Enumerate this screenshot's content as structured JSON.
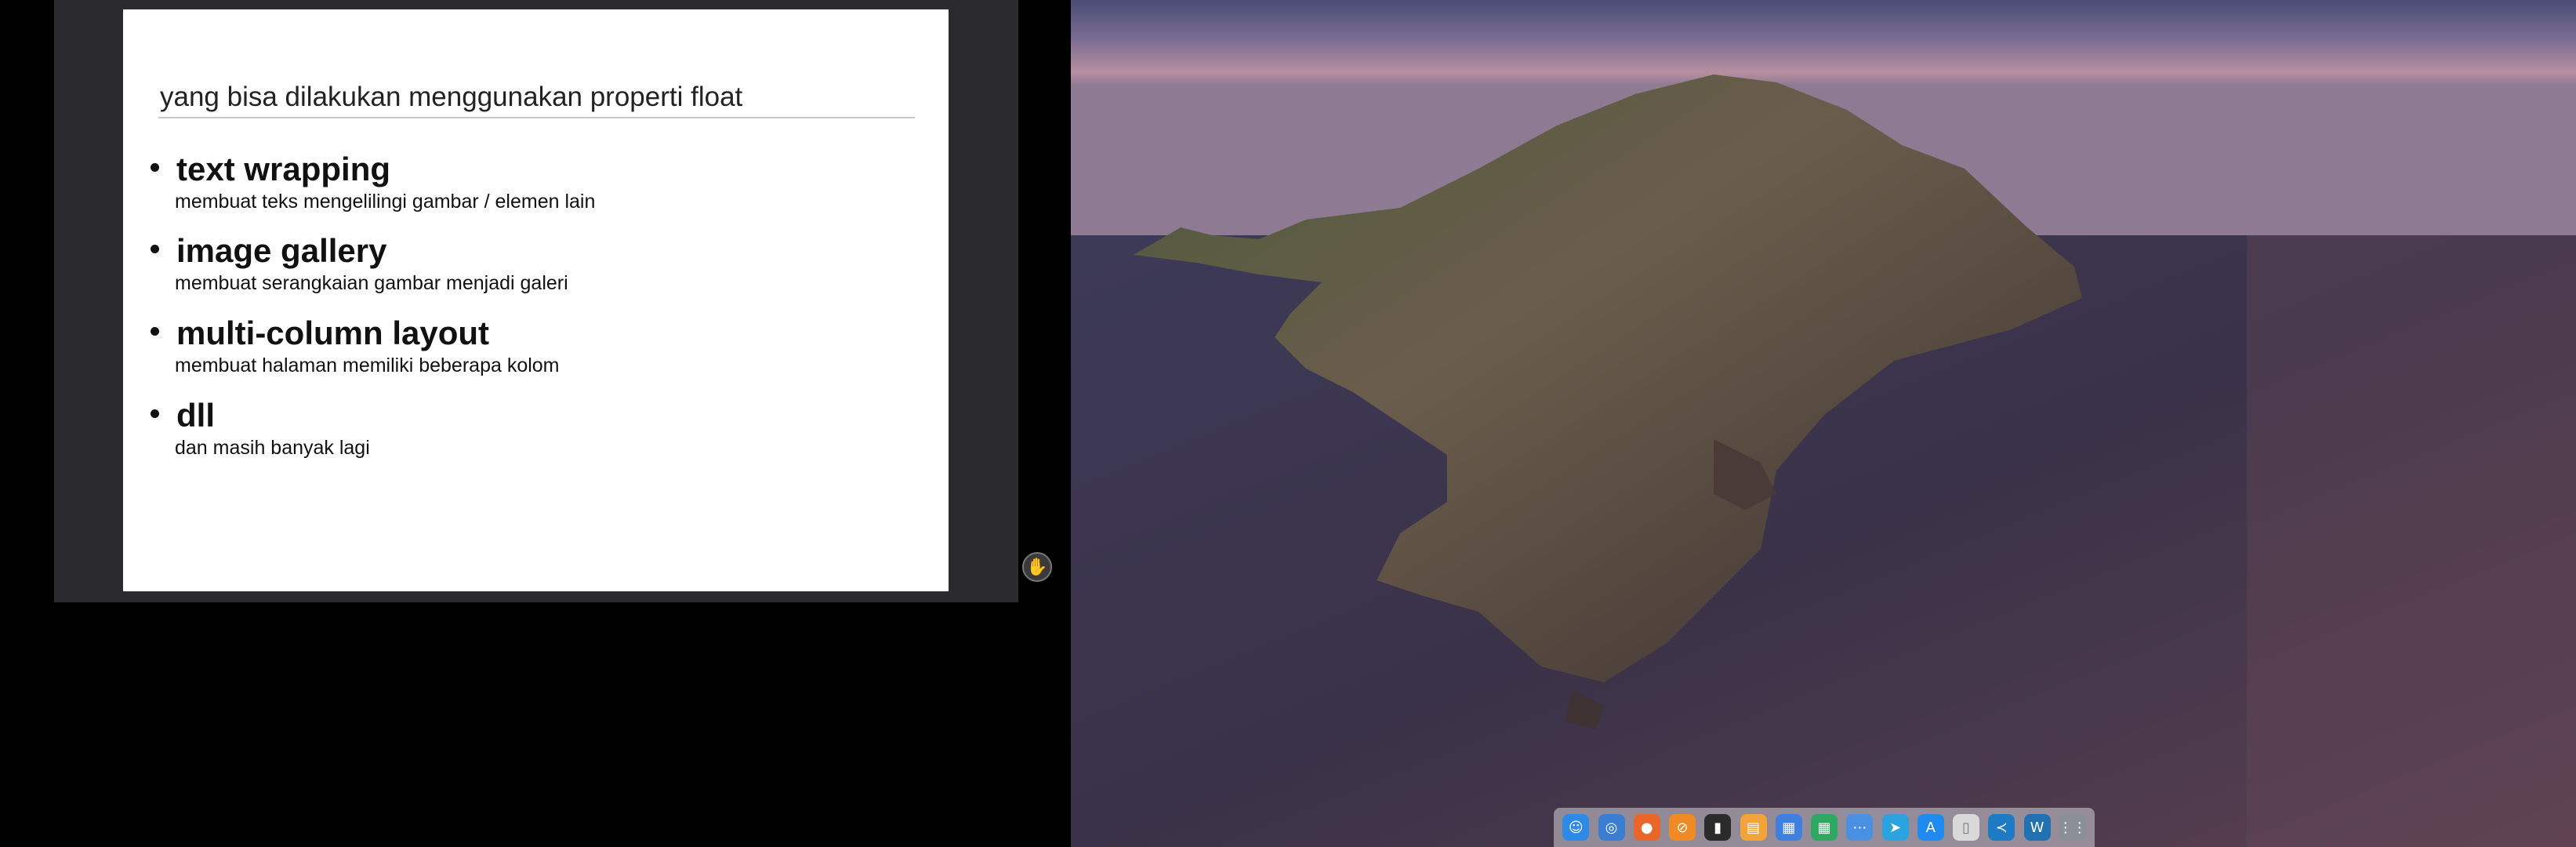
{
  "slide": {
    "title": "yang bisa dilakukan menggunakan properti float",
    "bullets": [
      {
        "heading": "text wrapping",
        "description": "membuat teks mengelilingi gambar / elemen lain"
      },
      {
        "heading": "image gallery",
        "description": "membuat serangkaian gambar menjadi galeri"
      },
      {
        "heading": "multi-column layout",
        "description": "membuat halaman memiliki beberapa kolom"
      },
      {
        "heading": "dll",
        "description": "dan masih banyak lagi"
      }
    ]
  },
  "presenter": {
    "hand_icon": "hand-icon"
  },
  "dock": {
    "items": [
      {
        "icon": "finder-icon",
        "color": "#2f8ae6"
      },
      {
        "icon": "chrome-icon",
        "color": "#3b7ed1"
      },
      {
        "icon": "firefox-icon",
        "color": "#e8662a"
      },
      {
        "icon": "safari-icon",
        "color": "#f08a24"
      },
      {
        "icon": "terminal-icon",
        "color": "#2b2b2b"
      },
      {
        "icon": "pages-icon",
        "color": "#f2a33a"
      },
      {
        "icon": "docs-icon",
        "color": "#3f7fe0"
      },
      {
        "icon": "sheets-icon",
        "color": "#2ea760"
      },
      {
        "icon": "messenger-icon",
        "color": "#4a90e2"
      },
      {
        "icon": "telegram-icon",
        "color": "#2aa3de"
      },
      {
        "icon": "app-store-icon",
        "color": "#1f8bf0"
      },
      {
        "icon": "file-icon",
        "color": "#d9d9d9"
      },
      {
        "icon": "vscode-icon",
        "color": "#1f7ac4"
      },
      {
        "icon": "wordpress-icon",
        "color": "#2171b1"
      },
      {
        "icon": "launchpad-icon",
        "color": "#8a8f98"
      }
    ]
  }
}
